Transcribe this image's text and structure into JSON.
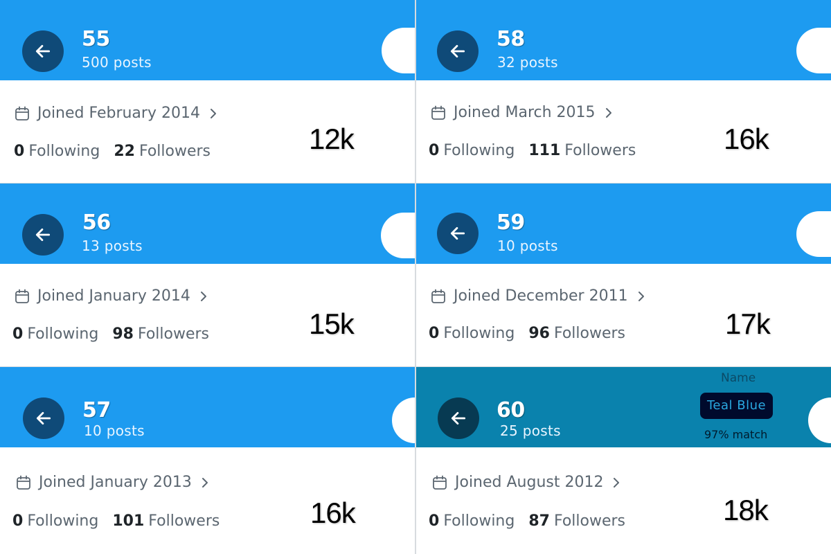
{
  "colors": {
    "header_blue": "#1d9bf0",
    "header_teal": "#0a82ad",
    "back_button_dark": "#0f4a78",
    "back_button_teal": "#073a52"
  },
  "panels": [
    {
      "number": "55",
      "posts": "500 posts",
      "joined": "Joined February 2014",
      "following_count": "0",
      "following_label": "Following",
      "followers_count": "22",
      "followers_label": "Followers",
      "big": "12k"
    },
    {
      "number": "58",
      "posts": "32 posts",
      "joined": "Joined March 2015",
      "following_count": "0",
      "following_label": "Following",
      "followers_count": "111",
      "followers_label": "Followers",
      "big": "16k"
    },
    {
      "number": "56",
      "posts": "13 posts",
      "joined": "Joined January 2014",
      "following_count": "0",
      "following_label": "Following",
      "followers_count": "98",
      "followers_label": "Followers",
      "big": "15k"
    },
    {
      "number": "59",
      "posts": "10 posts",
      "joined": "Joined December 2011",
      "following_count": "0",
      "following_label": "Following",
      "followers_count": "96",
      "followers_label": "Followers",
      "big": "17k"
    },
    {
      "number": "57",
      "posts": "10 posts",
      "joined": "Joined January 2013",
      "following_count": "0",
      "following_label": "Following",
      "followers_count": "101",
      "followers_label": "Followers",
      "big": "16k"
    },
    {
      "number": "60",
      "posts": "25 posts",
      "joined": "Joined August 2012",
      "following_count": "0",
      "following_label": "Following",
      "followers_count": "87",
      "followers_label": "Followers",
      "big": "18k",
      "color_name": {
        "label": "Name",
        "value": "Teal Blue",
        "match": "97% match"
      }
    }
  ],
  "icons": {
    "back": "arrow-left-icon",
    "calendar": "calendar-icon",
    "chevron": "chevron-right-icon"
  }
}
